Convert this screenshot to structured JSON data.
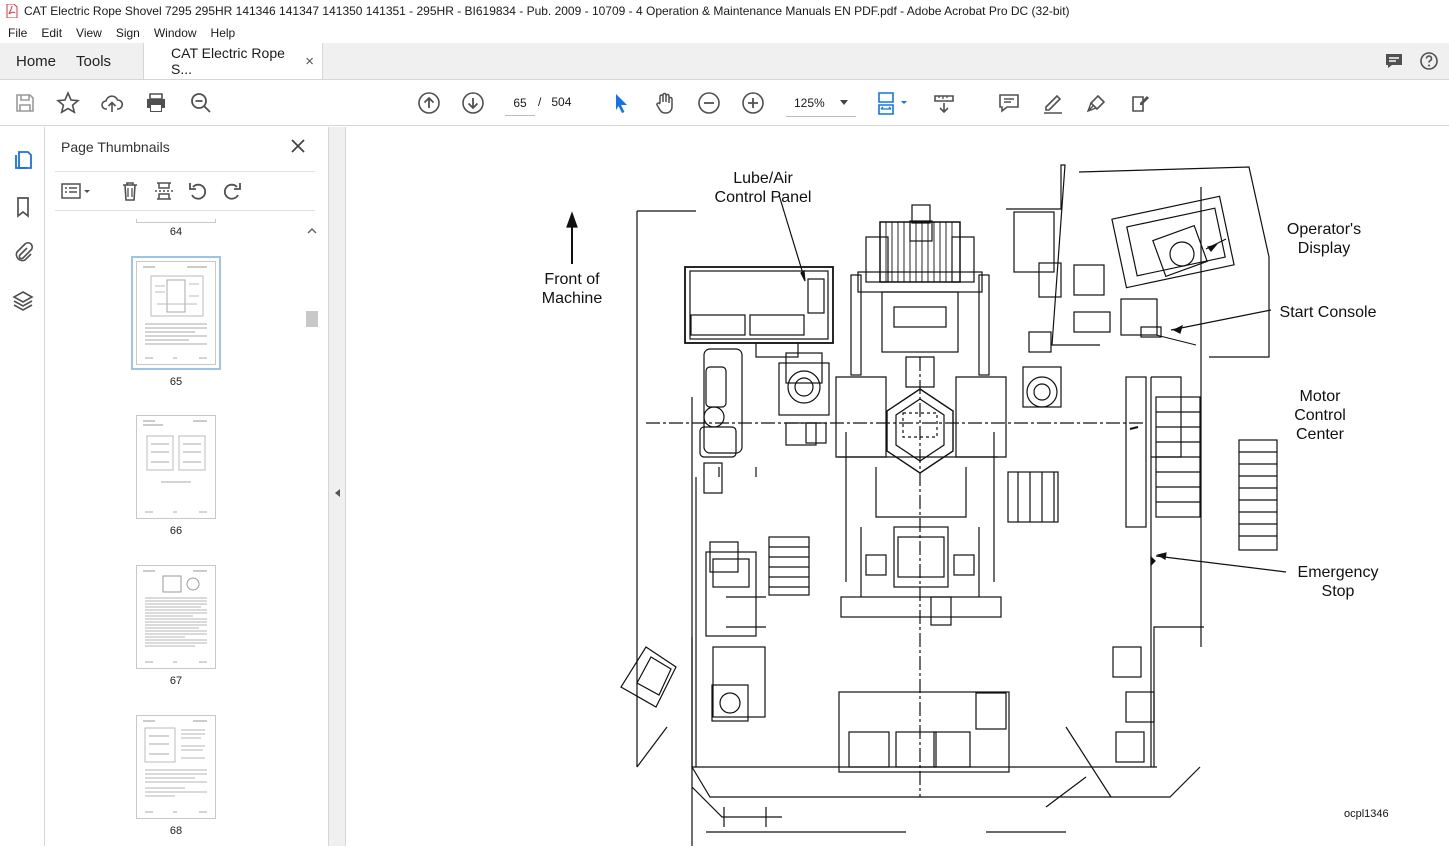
{
  "window": {
    "title": "CAT Electric Rope Shovel 7295 295HR 141346 141347 141350 141351 - 295HR - BI619834 - Pub. 2009 - 10709 - 4 Operation & Maintenance Manuals EN PDF.pdf - Adobe Acrobat Pro DC (32-bit)"
  },
  "menu": [
    "File",
    "Edit",
    "View",
    "Sign",
    "Window",
    "Help"
  ],
  "tabs": {
    "home": "Home",
    "tools": "Tools",
    "document": "CAT Electric Rope S...",
    "close_glyph": "×"
  },
  "toolbar": {
    "current_page": "65",
    "page_separator": "/",
    "total_pages": "504",
    "zoom": "125%"
  },
  "sidebar": {
    "title": "Page Thumbnails",
    "thumbnails": [
      {
        "page": "64"
      },
      {
        "page": "65",
        "selected": true
      },
      {
        "page": "66"
      },
      {
        "page": "67"
      },
      {
        "page": "68"
      }
    ]
  },
  "figure": {
    "labels": {
      "lube_air": "Lube/Air\nControl Panel",
      "front": "Front of\nMachine",
      "operators_display": "Operator's\nDisplay",
      "start_console": "Start Console",
      "motor_control": "Motor\nControl\nCenter",
      "emergency_stop": "Emergency\nStop"
    },
    "code": "ocpl1346"
  },
  "colors": {
    "accent_blue": "#1473e6",
    "acrobat_red": "#d7373f",
    "icon_gray": "#505050"
  }
}
